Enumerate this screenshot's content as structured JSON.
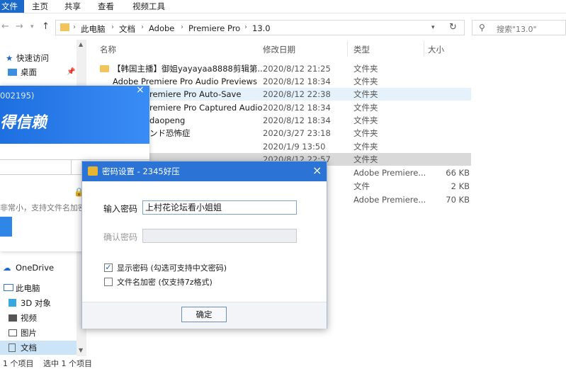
{
  "ribbon": {
    "tabs": [
      "文件",
      "主页",
      "共享",
      "查看",
      "视频工具"
    ]
  },
  "nav": {
    "breadcrumb": [
      "此电脑",
      "文档",
      "Adobe",
      "Premiere Pro",
      "13.0"
    ],
    "search_placeholder": "搜索\"13.0\""
  },
  "sidebar": {
    "items": [
      "快速访问",
      "桌面",
      "OneDrive",
      "此电脑",
      "3D 对象",
      "视频",
      "图片",
      "文档"
    ]
  },
  "columns": {
    "name": "名称",
    "date": "修改日期",
    "type": "类型",
    "size": "大小"
  },
  "files": [
    {
      "name": "【韩国主播】御姐yayayaa8888剪辑第...",
      "date": "2020/8/12 21:25",
      "type": "文件夹",
      "size": ""
    },
    {
      "name": "Adobe Premiere Pro Audio Previews",
      "date": "2020/8/12 18:34",
      "type": "文件夹",
      "size": ""
    },
    {
      "name": "remiere Pro Auto-Save",
      "date": "2020/8/12 22:38",
      "type": "文件夹",
      "size": ""
    },
    {
      "name": "remiere Pro Captured Audio",
      "date": "2020/8/12 18:34",
      "type": "文件夹",
      "size": ""
    },
    {
      "name": "daopeng",
      "date": "2020/8/12 18:34",
      "type": "文件夹",
      "size": ""
    },
    {
      "name": "ンド恐怖症",
      "date": "2020/3/27 23:18",
      "type": "文件夹",
      "size": ""
    },
    {
      "name": "",
      "date": "2020/1/9 13:50",
      "type": "文件夹",
      "size": ""
    },
    {
      "name": "",
      "date": "2020/8/12 22:57",
      "type": "文件夹",
      "size": ""
    },
    {
      "name": "",
      "date": "",
      "type": "Adobe Premiere...",
      "size": "66 KB"
    },
    {
      "name": "",
      "date": "",
      "type": "文件",
      "size": "2 KB"
    },
    {
      "name": "",
      "date": "",
      "type": "Adobe Premiere...",
      "size": "70 KB"
    }
  ],
  "status": {
    "count": "1 个项目",
    "selected": "选中 1 个项目"
  },
  "background_app": {
    "code": "002195)",
    "headline": "得信赖",
    "hint": "非常小，支持文件名加密"
  },
  "dialog": {
    "title": "密码设置 - 2345好压",
    "password_label": "输入密码",
    "password_value": "上村花论坛看小姐姐",
    "confirm_label": "确认密码",
    "confirm_value": "",
    "show_password_label": "显示密码 (勾选可支持中文密码)",
    "show_password_checked": true,
    "encrypt_names_label": "文件名加密 (仅支持7z格式)",
    "encrypt_names_checked": false,
    "ok_label": "确定"
  },
  "colors": {
    "accent": "#2b73d4",
    "selection": "#e5f1fb",
    "folder": "#f2c55c"
  }
}
